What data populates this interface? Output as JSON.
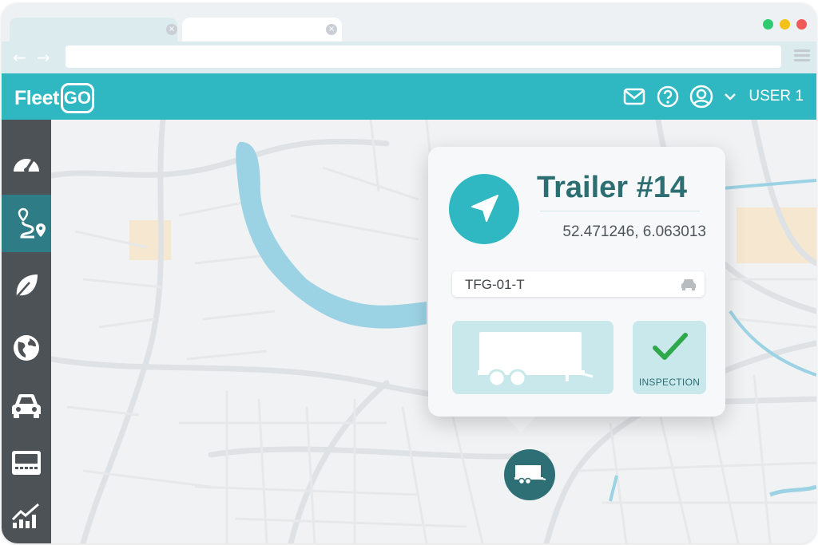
{
  "colors": {
    "brand": "#2fb8c2",
    "brand_dark": "#2e6f75",
    "sidebar": "#4d5257",
    "title": "#2d6e73",
    "window_dot_green": "#2ecc71",
    "window_dot_yellow": "#f5c01a",
    "window_dot_red": "#f25a5a"
  },
  "browser": {
    "tab_close_symbol": "×",
    "back_icon": "←",
    "forward_icon": "→"
  },
  "header": {
    "logo_text": "Fleet",
    "logo_box_text": "GO",
    "icons": [
      "mail-icon",
      "help-icon",
      "user-avatar-icon",
      "chevron-down-icon"
    ],
    "user_label": "USER 1"
  },
  "sidebar": {
    "items": [
      {
        "icon": "dashboard-gauge-icon",
        "active": false
      },
      {
        "icon": "route-icon",
        "active": true
      },
      {
        "icon": "leaf-icon",
        "active": false
      },
      {
        "icon": "globe-icon",
        "active": false
      },
      {
        "icon": "car-icon",
        "active": false
      },
      {
        "icon": "card-reader-icon",
        "active": false
      },
      {
        "icon": "chart-icon",
        "active": false
      }
    ]
  },
  "card": {
    "title": "Trailer #14",
    "coordinates": "52.471246, 6.063013",
    "plate": "TFG-01-T",
    "inspection_label": "INSPECTION"
  }
}
